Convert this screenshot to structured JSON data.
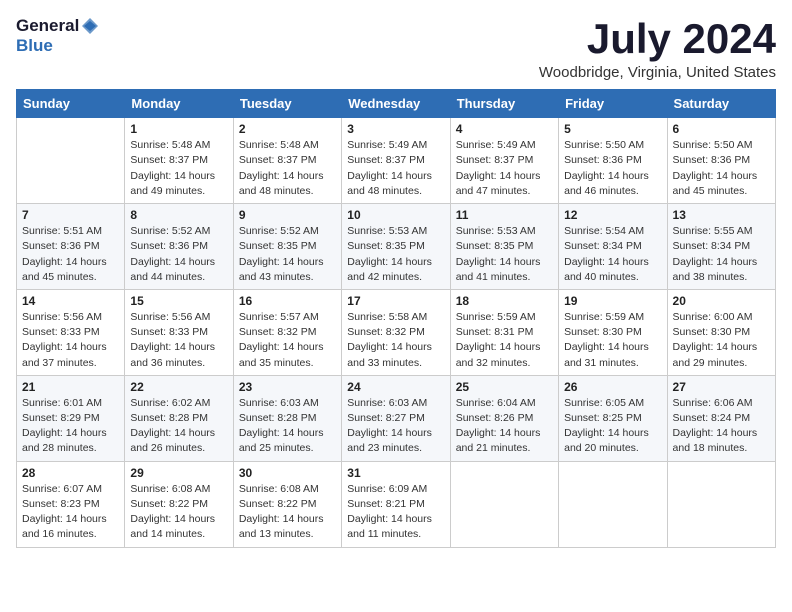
{
  "header": {
    "logo_general": "General",
    "logo_blue": "Blue",
    "month_title": "July 2024",
    "location": "Woodbridge, Virginia, United States"
  },
  "calendar": {
    "days_of_week": [
      "Sunday",
      "Monday",
      "Tuesday",
      "Wednesday",
      "Thursday",
      "Friday",
      "Saturday"
    ],
    "weeks": [
      [
        {
          "day": "",
          "info": ""
        },
        {
          "day": "1",
          "info": "Sunrise: 5:48 AM\nSunset: 8:37 PM\nDaylight: 14 hours\nand 49 minutes."
        },
        {
          "day": "2",
          "info": "Sunrise: 5:48 AM\nSunset: 8:37 PM\nDaylight: 14 hours\nand 48 minutes."
        },
        {
          "day": "3",
          "info": "Sunrise: 5:49 AM\nSunset: 8:37 PM\nDaylight: 14 hours\nand 48 minutes."
        },
        {
          "day": "4",
          "info": "Sunrise: 5:49 AM\nSunset: 8:37 PM\nDaylight: 14 hours\nand 47 minutes."
        },
        {
          "day": "5",
          "info": "Sunrise: 5:50 AM\nSunset: 8:36 PM\nDaylight: 14 hours\nand 46 minutes."
        },
        {
          "day": "6",
          "info": "Sunrise: 5:50 AM\nSunset: 8:36 PM\nDaylight: 14 hours\nand 45 minutes."
        }
      ],
      [
        {
          "day": "7",
          "info": "Sunrise: 5:51 AM\nSunset: 8:36 PM\nDaylight: 14 hours\nand 45 minutes."
        },
        {
          "day": "8",
          "info": "Sunrise: 5:52 AM\nSunset: 8:36 PM\nDaylight: 14 hours\nand 44 minutes."
        },
        {
          "day": "9",
          "info": "Sunrise: 5:52 AM\nSunset: 8:35 PM\nDaylight: 14 hours\nand 43 minutes."
        },
        {
          "day": "10",
          "info": "Sunrise: 5:53 AM\nSunset: 8:35 PM\nDaylight: 14 hours\nand 42 minutes."
        },
        {
          "day": "11",
          "info": "Sunrise: 5:53 AM\nSunset: 8:35 PM\nDaylight: 14 hours\nand 41 minutes."
        },
        {
          "day": "12",
          "info": "Sunrise: 5:54 AM\nSunset: 8:34 PM\nDaylight: 14 hours\nand 40 minutes."
        },
        {
          "day": "13",
          "info": "Sunrise: 5:55 AM\nSunset: 8:34 PM\nDaylight: 14 hours\nand 38 minutes."
        }
      ],
      [
        {
          "day": "14",
          "info": "Sunrise: 5:56 AM\nSunset: 8:33 PM\nDaylight: 14 hours\nand 37 minutes."
        },
        {
          "day": "15",
          "info": "Sunrise: 5:56 AM\nSunset: 8:33 PM\nDaylight: 14 hours\nand 36 minutes."
        },
        {
          "day": "16",
          "info": "Sunrise: 5:57 AM\nSunset: 8:32 PM\nDaylight: 14 hours\nand 35 minutes."
        },
        {
          "day": "17",
          "info": "Sunrise: 5:58 AM\nSunset: 8:32 PM\nDaylight: 14 hours\nand 33 minutes."
        },
        {
          "day": "18",
          "info": "Sunrise: 5:59 AM\nSunset: 8:31 PM\nDaylight: 14 hours\nand 32 minutes."
        },
        {
          "day": "19",
          "info": "Sunrise: 5:59 AM\nSunset: 8:30 PM\nDaylight: 14 hours\nand 31 minutes."
        },
        {
          "day": "20",
          "info": "Sunrise: 6:00 AM\nSunset: 8:30 PM\nDaylight: 14 hours\nand 29 minutes."
        }
      ],
      [
        {
          "day": "21",
          "info": "Sunrise: 6:01 AM\nSunset: 8:29 PM\nDaylight: 14 hours\nand 28 minutes."
        },
        {
          "day": "22",
          "info": "Sunrise: 6:02 AM\nSunset: 8:28 PM\nDaylight: 14 hours\nand 26 minutes."
        },
        {
          "day": "23",
          "info": "Sunrise: 6:03 AM\nSunset: 8:28 PM\nDaylight: 14 hours\nand 25 minutes."
        },
        {
          "day": "24",
          "info": "Sunrise: 6:03 AM\nSunset: 8:27 PM\nDaylight: 14 hours\nand 23 minutes."
        },
        {
          "day": "25",
          "info": "Sunrise: 6:04 AM\nSunset: 8:26 PM\nDaylight: 14 hours\nand 21 minutes."
        },
        {
          "day": "26",
          "info": "Sunrise: 6:05 AM\nSunset: 8:25 PM\nDaylight: 14 hours\nand 20 minutes."
        },
        {
          "day": "27",
          "info": "Sunrise: 6:06 AM\nSunset: 8:24 PM\nDaylight: 14 hours\nand 18 minutes."
        }
      ],
      [
        {
          "day": "28",
          "info": "Sunrise: 6:07 AM\nSunset: 8:23 PM\nDaylight: 14 hours\nand 16 minutes."
        },
        {
          "day": "29",
          "info": "Sunrise: 6:08 AM\nSunset: 8:22 PM\nDaylight: 14 hours\nand 14 minutes."
        },
        {
          "day": "30",
          "info": "Sunrise: 6:08 AM\nSunset: 8:22 PM\nDaylight: 14 hours\nand 13 minutes."
        },
        {
          "day": "31",
          "info": "Sunrise: 6:09 AM\nSunset: 8:21 PM\nDaylight: 14 hours\nand 11 minutes."
        },
        {
          "day": "",
          "info": ""
        },
        {
          "day": "",
          "info": ""
        },
        {
          "day": "",
          "info": ""
        }
      ]
    ]
  }
}
